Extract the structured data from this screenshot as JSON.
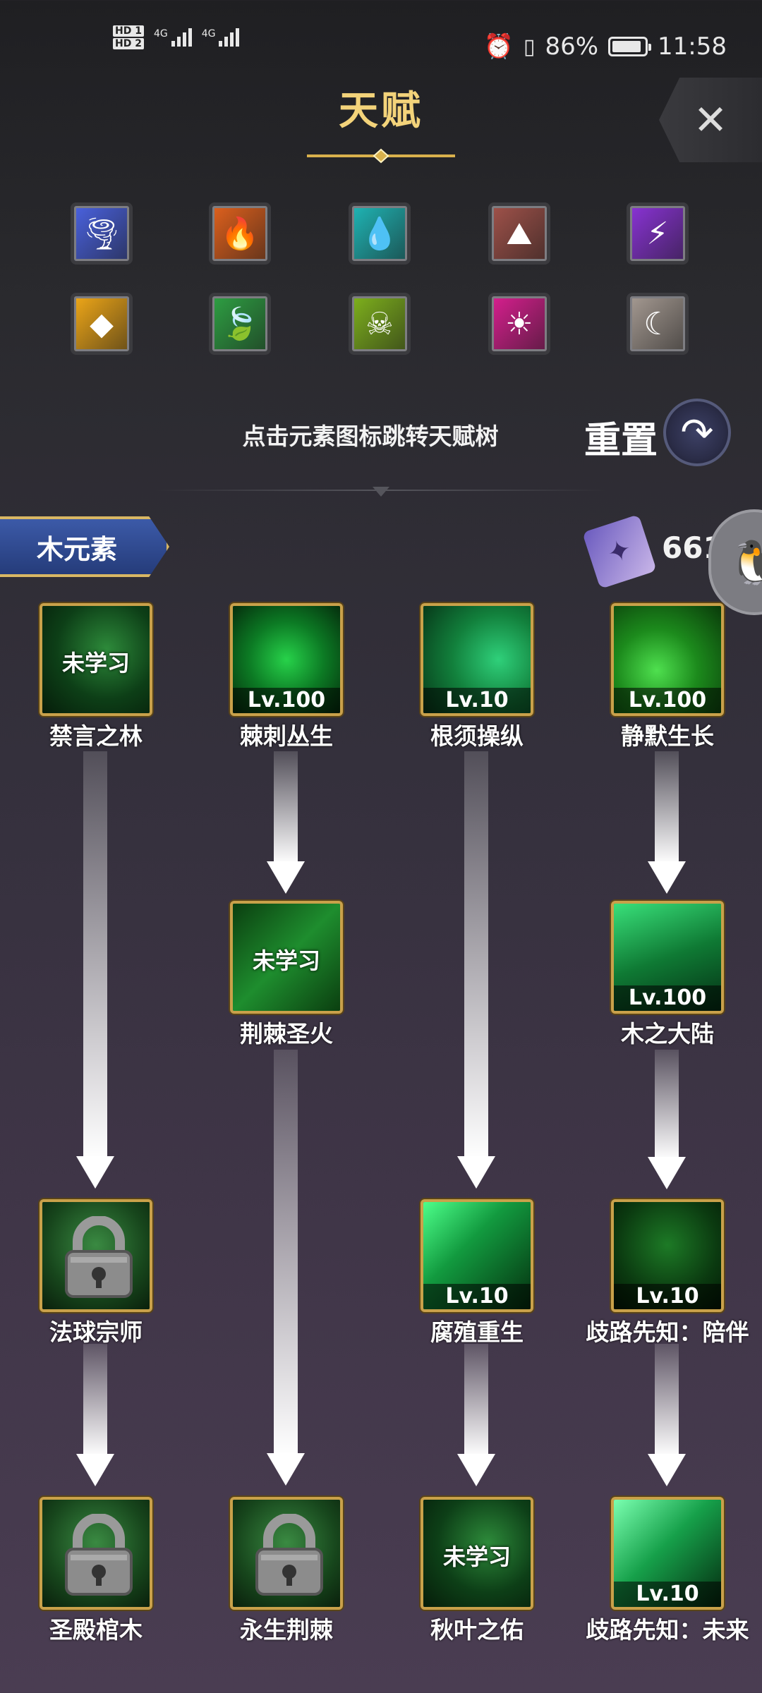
{
  "status_bar": {
    "hd1": "HD 1",
    "hd2": "HD 2",
    "net1": "4G",
    "net2": "4G",
    "battery_pct": "86%",
    "time": "11:58"
  },
  "header": {
    "title": "天赋",
    "close_icon": "✕"
  },
  "elements": [
    {
      "name": "wind-element",
      "color": "#4a62e0",
      "glyph": "🌪"
    },
    {
      "name": "fire-element",
      "color": "#e0611d",
      "glyph": "🔥"
    },
    {
      "name": "water-element",
      "color": "#1fb6b6",
      "glyph": "💧"
    },
    {
      "name": "earth-element",
      "color": "#a0524a",
      "glyph": "⛰"
    },
    {
      "name": "thunder-element",
      "color": "#8a33d6",
      "glyph": "⚡"
    },
    {
      "name": "light-element",
      "color": "#f0a818",
      "glyph": "◆"
    },
    {
      "name": "wood-element",
      "color": "#2ea043",
      "glyph": "🍃"
    },
    {
      "name": "poison-element",
      "color": "#7fb21c",
      "glyph": "☠"
    },
    {
      "name": "sun-element",
      "color": "#d81f8f",
      "glyph": "☀"
    },
    {
      "name": "moon-element",
      "color": "#a59a92",
      "glyph": "☾"
    }
  ],
  "hint": "点击元素图标跳转天赋树",
  "reset_label": "重置",
  "reset_icon": "↷",
  "current_element": "木元素",
  "points": "6616",
  "nodes": [
    {
      "name": "禁言之林",
      "status": "未学习",
      "bg": "g1"
    },
    {
      "name": "棘刺丛生",
      "status": "Lv.100",
      "bg": "g2"
    },
    {
      "name": "根须操纵",
      "status": "Lv.10",
      "bg": "g3"
    },
    {
      "name": "静默生长",
      "status": "Lv.100",
      "bg": "g4"
    },
    {
      "name": "荆棘圣火",
      "status": "未学习",
      "bg": "g5"
    },
    {
      "name": "木之大陆",
      "status": "Lv.100",
      "bg": "g6"
    },
    {
      "name": "法球宗师",
      "status": "locked",
      "bg": "glock"
    },
    {
      "name": "腐殖重生",
      "status": "Lv.10",
      "bg": "g7"
    },
    {
      "name": "歧路先知：陪伴",
      "status": "Lv.10",
      "bg": "g8"
    },
    {
      "name": "圣殿棺木",
      "status": "locked",
      "bg": "glock"
    },
    {
      "name": "永生荆棘",
      "status": "locked",
      "bg": "glock"
    },
    {
      "name": "秋叶之佑",
      "status": "未学习",
      "bg": "g1"
    },
    {
      "name": "歧路先知：未来",
      "status": "Lv.10",
      "bg": "g9"
    }
  ]
}
